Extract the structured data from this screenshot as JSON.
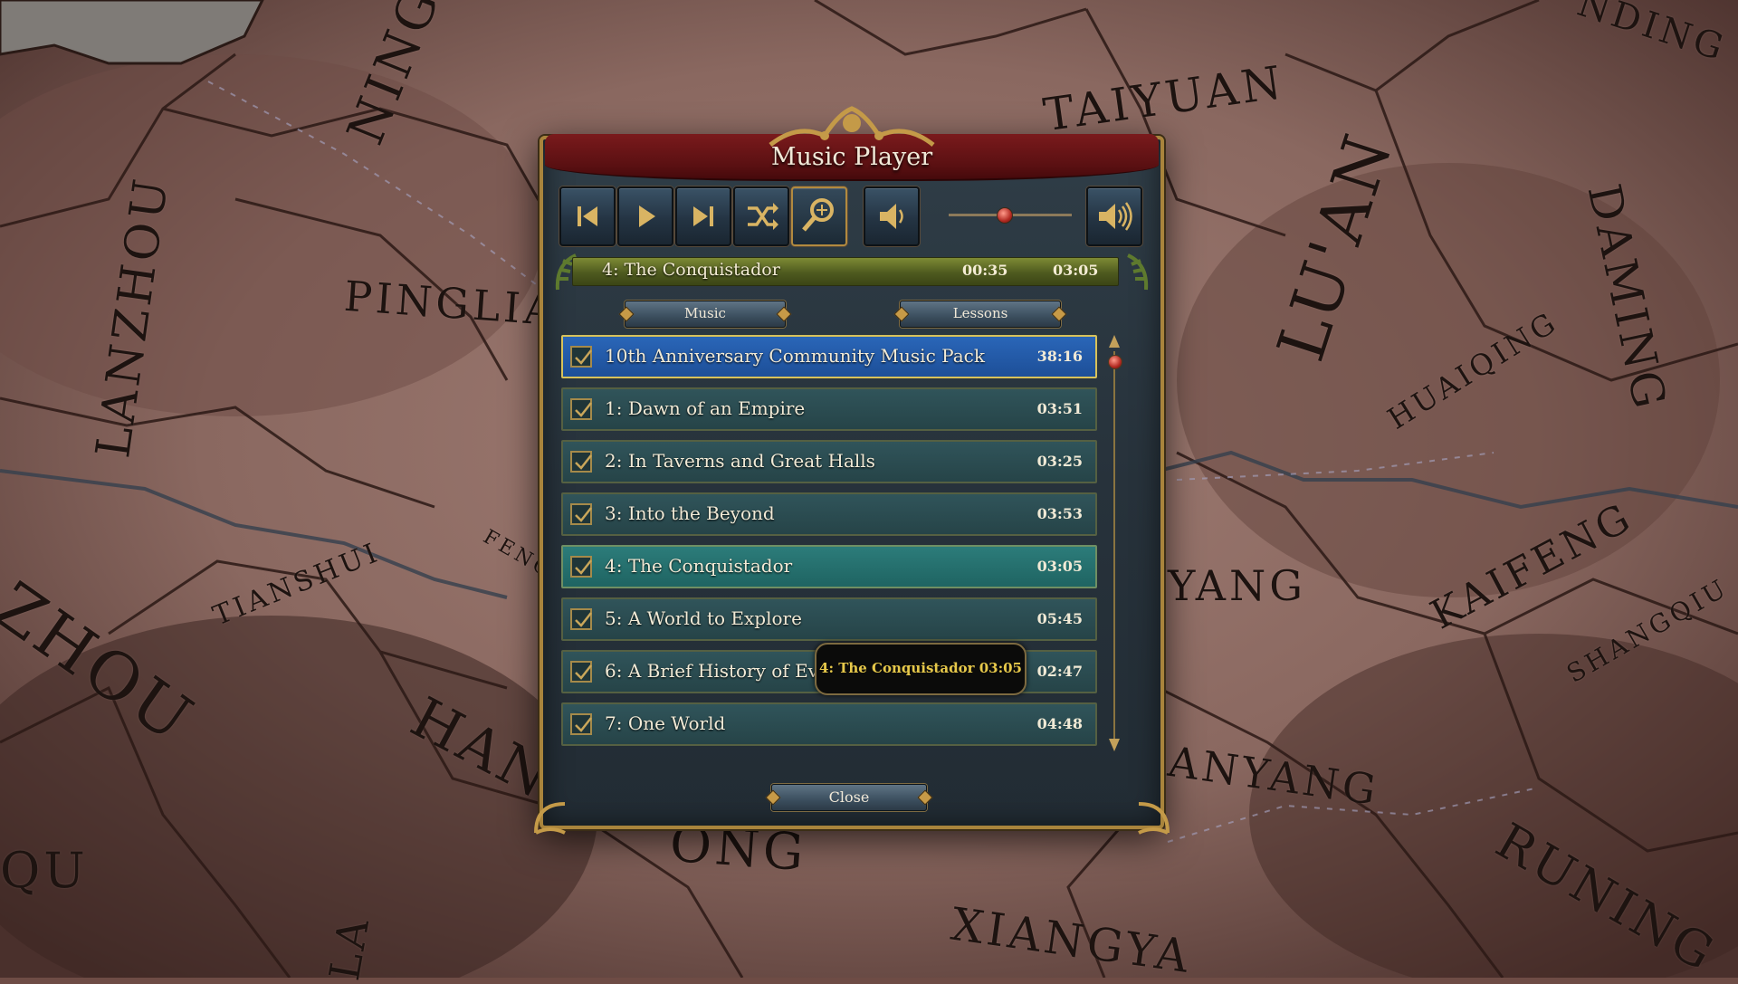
{
  "map": {
    "labels": [
      "NING",
      "TAIYUAN",
      "NDING",
      "LANZHOU",
      "PINGLIA",
      "LU'AN",
      "DAMING",
      "HUAIQING",
      "KAIFENG",
      "TIANSHUI",
      "FENG",
      "YANG",
      "SHANGQIU",
      "ZHOU",
      "HAN",
      "ANYANG",
      "RUNING",
      "QU",
      "XIANGYA",
      "ONG",
      "LA"
    ]
  },
  "player": {
    "title": "Music Player",
    "toolbar": {
      "prev_icon": "skip-previous-icon",
      "play_icon": "play-icon",
      "next_icon": "skip-next-icon",
      "shuffle_icon": "shuffle-icon",
      "search_icon": "magnifier-icon",
      "mute_icon": "speaker-low-icon",
      "volume_icon": "speaker-high-icon",
      "volume_level": 0.45
    },
    "now_playing": {
      "title": "4: The Conquistador",
      "position": "00:35",
      "duration": "03:05"
    },
    "tabs": [
      "Music",
      "Lessons"
    ],
    "tracks": [
      {
        "title": "10th Anniversary Community Music Pack",
        "duration": "38:16",
        "checked": true,
        "state": "selected"
      },
      {
        "title": "1: Dawn of an Empire",
        "duration": "03:51",
        "checked": true,
        "state": ""
      },
      {
        "title": "2: In Taverns and Great Halls",
        "duration": "03:25",
        "checked": true,
        "state": ""
      },
      {
        "title": "3: Into the Beyond",
        "duration": "03:53",
        "checked": true,
        "state": ""
      },
      {
        "title": "4: The Conquistador",
        "duration": "03:05",
        "checked": true,
        "state": "playing"
      },
      {
        "title": "5: A World to Explore",
        "duration": "05:45",
        "checked": true,
        "state": ""
      },
      {
        "title": "6: A Brief History of Everyth",
        "duration": "02:47",
        "checked": true,
        "state": ""
      },
      {
        "title": "7: One World",
        "duration": "04:48",
        "checked": true,
        "state": ""
      }
    ],
    "tooltip": "4: The Conquistador 03:05",
    "close_label": "Close",
    "colors": {
      "accent_gold": "#c79a47",
      "selected_row": "#2a66b8",
      "playing_row": "#2c7c7a",
      "banner_red": "#7a1a1c"
    }
  }
}
